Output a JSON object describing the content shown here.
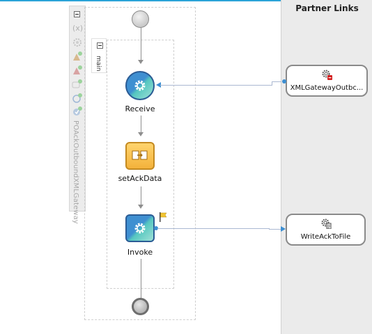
{
  "process": {
    "name": "POAckOutboundXMLGateway",
    "scope_label": "main"
  },
  "activities": [
    {
      "label": "Receive",
      "type": "receive"
    },
    {
      "label": "setAckData",
      "type": "assign"
    },
    {
      "label": "Invoke",
      "type": "invoke"
    }
  ],
  "partner_links": {
    "title": "Partner Links",
    "items": [
      {
        "label": "XMLGatewayOutbc...",
        "icon": "adapter-error-icon"
      },
      {
        "label": "WriteAckToFile",
        "icon": "file-adapter-icon"
      }
    ]
  },
  "toolbar": {
    "icons": [
      "collapse-icon",
      "variables-icon",
      "correlation-icon",
      "add-warning-icon",
      "add-error-icon",
      "add-message-icon",
      "add-timer-icon",
      "add-event-icon"
    ]
  },
  "colors": {
    "accent_line": "#2ba4d8",
    "activity_blue": "#3f8fd1",
    "assign_orange": "#f3b23b",
    "link_arrow": "#3d8fd2"
  }
}
